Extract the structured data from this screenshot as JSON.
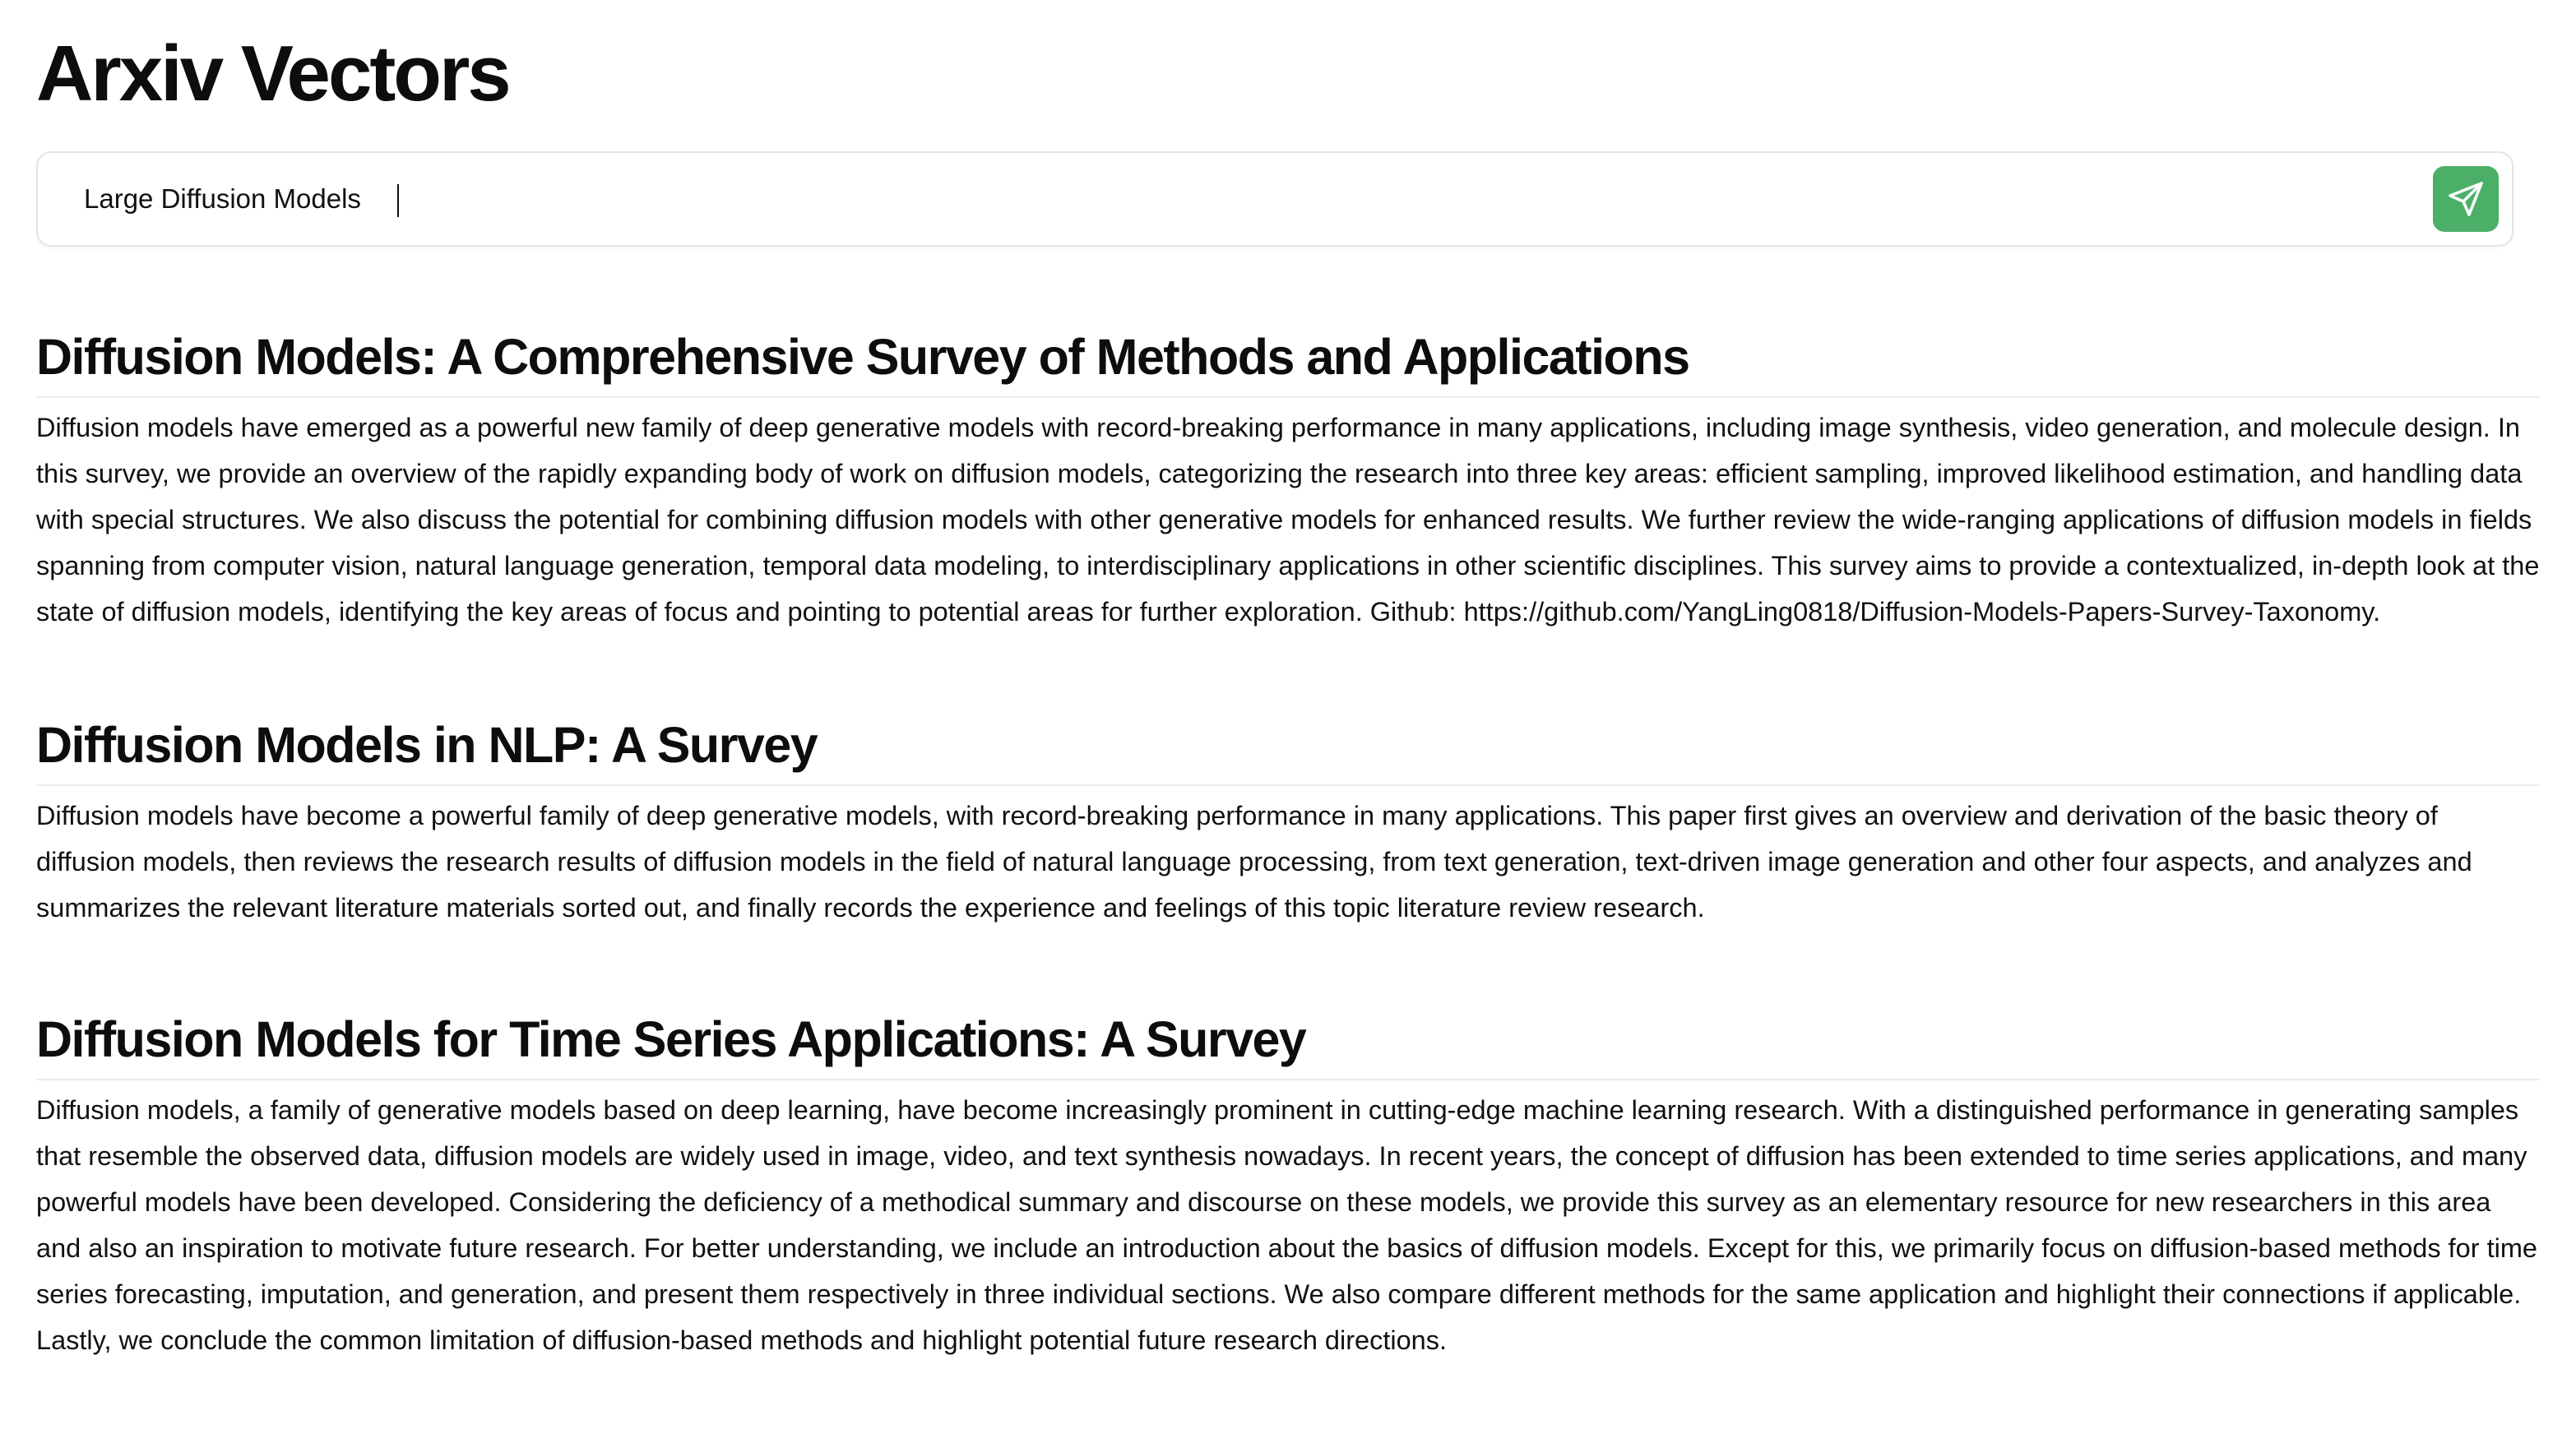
{
  "app": {
    "title": "Arxiv Vectors"
  },
  "search": {
    "value": "Large Diffusion Models",
    "placeholder": "",
    "send_icon": "send-icon",
    "accent_color": "#4caf68"
  },
  "results": [
    {
      "title": "Diffusion Models: A Comprehensive Survey of Methods and Applications",
      "abstract": "Diffusion models have emerged as a powerful new family of deep generative models with record-breaking performance in many applications, including image synthesis, video generation, and molecule design. In this survey, we provide an overview of the rapidly expanding body of work on diffusion models, categorizing the research into three key areas: efficient sampling, improved likelihood estimation, and handling data with special structures. We also discuss the potential for combining diffusion models with other generative models for enhanced results. We further review the wide-ranging applications of diffusion models in fields spanning from computer vision, natural language generation, temporal data modeling, to interdisciplinary applications in other scientific disciplines. This survey aims to provide a contextualized, in-depth look at the state of diffusion models, identifying the key areas of focus and pointing to potential areas for further exploration. Github: https://github.com/YangLing0818/Diffusion-Models-Papers-Survey-Taxonomy."
    },
    {
      "title": "Diffusion Models in NLP: A Survey",
      "abstract": "Diffusion models have become a powerful family of deep generative models, with record-breaking performance in many applications. This paper first gives an overview and derivation of the basic theory of diffusion models, then reviews the research results of diffusion models in the field of natural language processing, from text generation, text-driven image generation and other four aspects, and analyzes and summarizes the relevant literature materials sorted out, and finally records the experience and feelings of this topic literature review research."
    },
    {
      "title": "Diffusion Models for Time Series Applications: A Survey",
      "abstract": "Diffusion models, a family of generative models based on deep learning, have become increasingly prominent in cutting-edge machine learning research. With a distinguished performance in generating samples that resemble the observed data, diffusion models are widely used in image, video, and text synthesis nowadays. In recent years, the concept of diffusion has been extended to time series applications, and many powerful models have been developed. Considering the deficiency of a methodical summary and discourse on these models, we provide this survey as an elementary resource for new researchers in this area and also an inspiration to motivate future research. For better understanding, we include an introduction about the basics of diffusion models. Except for this, we primarily focus on diffusion-based methods for time series forecasting, imputation, and generation, and present them respectively in three individual sections. We also compare different methods for the same application and highlight their connections if applicable. Lastly, we conclude the common limitation of diffusion-based methods and highlight potential future research directions."
    }
  ]
}
